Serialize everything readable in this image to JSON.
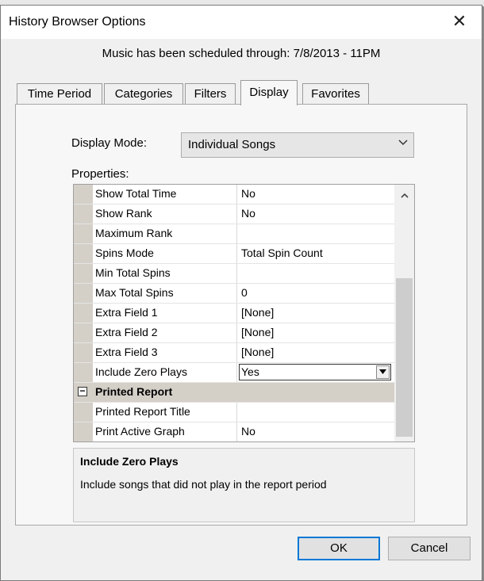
{
  "window": {
    "title": "History Browser Options",
    "close_glyph": "✕"
  },
  "subtitle": "Music has been scheduled through: 7/8/2013 - 11PM",
  "tabs": [
    {
      "label": "Time Period",
      "active": false
    },
    {
      "label": "Categories",
      "active": false
    },
    {
      "label": "Filters",
      "active": false
    },
    {
      "label": "Display",
      "active": true
    },
    {
      "label": "Favorites",
      "active": false
    }
  ],
  "display_mode": {
    "label": "Display Mode:",
    "value": "Individual Songs"
  },
  "properties": {
    "label": "Properties:",
    "rows": [
      {
        "name": "Show Total Time",
        "value": "No"
      },
      {
        "name": "Show Rank",
        "value": "No"
      },
      {
        "name": "Maximum Rank",
        "value": ""
      },
      {
        "name": "Spins Mode",
        "value": "Total Spin Count"
      },
      {
        "name": "Min Total Spins",
        "value": ""
      },
      {
        "name": "Max Total Spins",
        "value": "0"
      },
      {
        "name": "Extra Field 1",
        "value": "[None]"
      },
      {
        "name": "Extra Field 2",
        "value": "[None]"
      },
      {
        "name": "Extra Field 3",
        "value": "[None]"
      },
      {
        "name": "Include Zero Plays",
        "value": "Yes",
        "editing": true
      },
      {
        "name": "Printed Report",
        "category": true,
        "expander": "−"
      },
      {
        "name": "Printed Report Title",
        "value": ""
      },
      {
        "name": "Print Active Graph",
        "value": "No"
      }
    ]
  },
  "help": {
    "title": "Include Zero Plays",
    "description": "Include songs that did not play in the report period"
  },
  "buttons": {
    "ok": "OK",
    "cancel": "Cancel"
  }
}
